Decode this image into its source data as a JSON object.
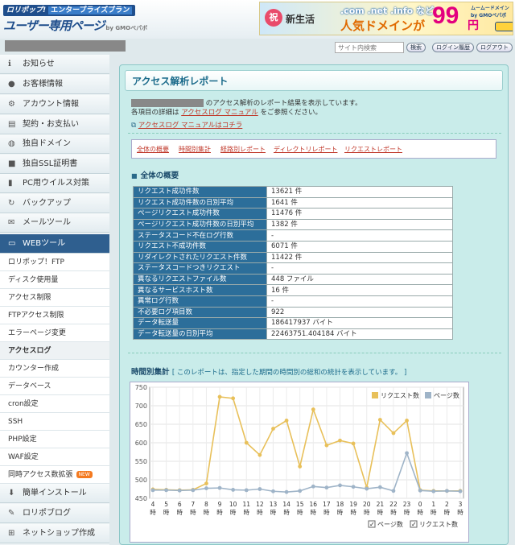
{
  "header": {
    "logo_top": "ロリポップ!",
    "logo_badge": "エンタープライズプラン",
    "logo_main": "ユーザー専用ページ",
    "logo_by": "by GMOペパボ",
    "banner": {
      "badge": "祝",
      "new_life": "新生活",
      "tlds": ".com .net .info など",
      "popular": "人気ドメインが",
      "price": "99",
      "yen": "円",
      "tag": "ムームードメイン by GMOペパボ"
    }
  },
  "toolbar": {
    "search_placeholder": "サイト内検索",
    "search_btn": "検索",
    "login_history_btn": "ログイン履歴",
    "logout_btn": "ログアウト"
  },
  "sidebar": {
    "items": [
      {
        "label": "お知らせ",
        "icon": "info-icon"
      },
      {
        "label": "お客様情報",
        "icon": "user-icon"
      },
      {
        "label": "アカウント情報",
        "icon": "gear-icon"
      },
      {
        "label": "契約・お支払い",
        "icon": "document-icon"
      },
      {
        "label": "独自ドメイン",
        "icon": "globe-icon"
      },
      {
        "label": "独自SSL証明書",
        "icon": "lock-icon"
      },
      {
        "label": "PC用ウイルス対策",
        "icon": "shield-icon"
      },
      {
        "label": "バックアップ",
        "icon": "backup-icon"
      },
      {
        "label": "メールツール",
        "icon": "mail-icon"
      },
      {
        "label": "WEBツール",
        "icon": "monitor-icon"
      }
    ],
    "subitems": [
      "ロリポップ！FTP",
      "ディスク使用量",
      "アクセス制限",
      "FTPアクセス制限",
      "エラーページ変更",
      "アクセスログ",
      "カウンター作成",
      "データベース",
      "cron設定",
      "SSH",
      "PHP設定",
      "WAF設定",
      "同時アクセス数拡張"
    ],
    "new_badge": "NEW",
    "bottom": [
      {
        "label": "簡単インストール",
        "icon": "download-icon"
      },
      {
        "label": "ロリポブログ",
        "icon": "pencil-icon"
      },
      {
        "label": "ネットショップ作成",
        "icon": "cart-icon"
      }
    ]
  },
  "main": {
    "title": "アクセス解析レポート",
    "intro_line1": "のアクセス解析のレポート結果を表示しています。",
    "intro_line2a": "各項目の詳細は",
    "intro_link": "アクセスログ マニュアル",
    "intro_line2b": "をご参照ください。",
    "manual_link": "アクセスログ マニュアルはコチラ",
    "tabs": [
      "全体の概要",
      "時間別集計",
      "経路別レポート",
      "ディレクトリレポート",
      "リクエストレポート"
    ],
    "summary_heading": "全体の概要",
    "summary": [
      {
        "k": "リクエスト成功件数",
        "v": "13621 件"
      },
      {
        "k": "リクエスト成功件数の日別平均",
        "v": "1641 件"
      },
      {
        "k": "ページリクエスト成功件数",
        "v": "11476 件"
      },
      {
        "k": "ページリクエスト成功件数の日別平均",
        "v": "1382 件"
      },
      {
        "k": "ステータスコード不在ログ行数",
        "v": "-"
      },
      {
        "k": "リクエスト不成功件数",
        "v": "6071 件"
      },
      {
        "k": "リダイレクトされたリクエスト件数",
        "v": "11422 件"
      },
      {
        "k": "ステータスコードつきリクエスト",
        "v": "-"
      },
      {
        "k": "異なるリクエストファイル数",
        "v": "448 ファイル"
      },
      {
        "k": "異なるサービスホスト数",
        "v": "16 件"
      },
      {
        "k": "異常ログ行数",
        "v": "-"
      },
      {
        "k": "不必要ログ項目数",
        "v": "922"
      },
      {
        "k": "データ転送量",
        "v": "186417937 バイト"
      },
      {
        "k": "データ転送量の日別平均",
        "v": "22463751.404184 バイト"
      }
    ],
    "hourly_heading": "時間別集計",
    "hourly_note": "[ このレポートは、指定した期間の時間別の総和の統計を表示しています。 ]",
    "checkbox_page": "ページ数",
    "checkbox_request": "リクエスト数"
  },
  "colors": {
    "request": "#e8c05a",
    "page": "#9fb4c8",
    "nav_active": "#2f5f8f"
  },
  "chart_data": {
    "type": "line",
    "categories": [
      "4\n時",
      "5\n時",
      "6\n時",
      "7\n時",
      "8\n時",
      "9\n時",
      "10\n時",
      "11\n時",
      "12\n時",
      "13\n時",
      "14\n時",
      "15\n時",
      "16\n時",
      "17\n時",
      "18\n時",
      "19\n時",
      "20\n時",
      "21\n時",
      "22\n時",
      "23\n時",
      "0\n時",
      "1\n時",
      "2\n時",
      "3\n時"
    ],
    "x_ticks": [
      "4",
      "5",
      "6",
      "7",
      "8",
      "9",
      "10",
      "11",
      "12",
      "13",
      "14",
      "15",
      "16",
      "17",
      "18",
      "19",
      "20",
      "21",
      "22",
      "23",
      "0",
      "1",
      "2",
      "3"
    ],
    "x_unit": "時",
    "series": [
      {
        "name": "リクエスト数",
        "values": [
          474,
          473,
          472,
          473,
          490,
          724,
          720,
          600,
          567,
          638,
          660,
          536,
          690,
          593,
          606,
          598,
          479,
          662,
          626,
          660,
          472,
          470,
          470,
          470
        ]
      },
      {
        "name": "ページ数",
        "values": [
          472,
          472,
          471,
          472,
          477,
          478,
          473,
          472,
          475,
          469,
          467,
          470,
          482,
          479,
          485,
          481,
          476,
          480,
          470,
          572,
          471,
          469,
          470,
          469
        ]
      }
    ],
    "ylim": [
      450,
      750
    ],
    "yticks": [
      450,
      500,
      550,
      600,
      650,
      700,
      750
    ],
    "grid": true,
    "legend": "top-right"
  }
}
